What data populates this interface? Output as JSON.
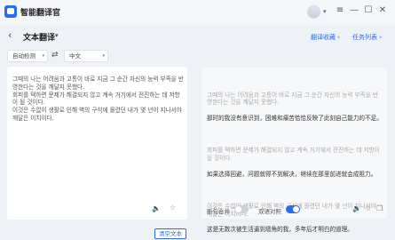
{
  "app": {
    "title": "智能翻译官",
    "window_controls": {
      "settings": "≡",
      "minimize": "—",
      "maximize": "☐",
      "close": "✕"
    }
  },
  "header": {
    "back_glyph": "‹",
    "title": "文本翻译",
    "caret": "▾",
    "links": [
      "翻译收藏",
      "任务列表"
    ],
    "link_arrow": "›"
  },
  "languages": {
    "source": "自动检测",
    "target": "中文",
    "swap_glyph": "⇄",
    "caret": "▾"
  },
  "source_text": "그때의 나는 어려움과 고통이 바로 지금 그 순간 자신의 능력 부족을 반영한다는 것을 깨달지 못했다.\n회피를 택하면 문제가 해결되지 않고 계속 거기에서 전진하는 데 저항이 될 것이다.\n이것은 수없이 생활로 인해 벽의 구석에 몰렸던 내가 몇 년이 지나서야 깨달은 이치이다.",
  "translation": [
    {
      "ko": "그때의 나는 어려움과 고통이 바로 지금 그 순간 자신의 능력 부족을 반영한다는 것을 깨달지 못했다.",
      "zh": "那时的我没有意识到，困难和痛苦恰恰反映了此刻自己能力的不足。"
    },
    {
      "ko": "회피를 택하면 문제가 해결되지 않고 계속 거기에서 전진하는 데 저항이 될 것이다.",
      "zh": "如果选择回避，问题就得不到解决，继续在那里前进就会成阻力。"
    },
    {
      "ko": "이것은 수없이 생활로 인해 벽의 구석에 몰렸던 내가 몇 년이 지나서야 깨달은 이치이다.",
      "zh": "这是无数次被生活逼到墙角的我，多年后才明白的道理。"
    }
  ],
  "toggles": {
    "paragraph_merge": {
      "label": "断句合并",
      "on": false
    },
    "bilingual": {
      "label": "双语对照",
      "on": true
    }
  },
  "icons": {
    "speaker": "🔈",
    "star": "☆",
    "copy": "❐"
  },
  "clear_button": "清空文本",
  "colors": {
    "accent": "#2b6bf3",
    "background": "#eef1f6"
  }
}
